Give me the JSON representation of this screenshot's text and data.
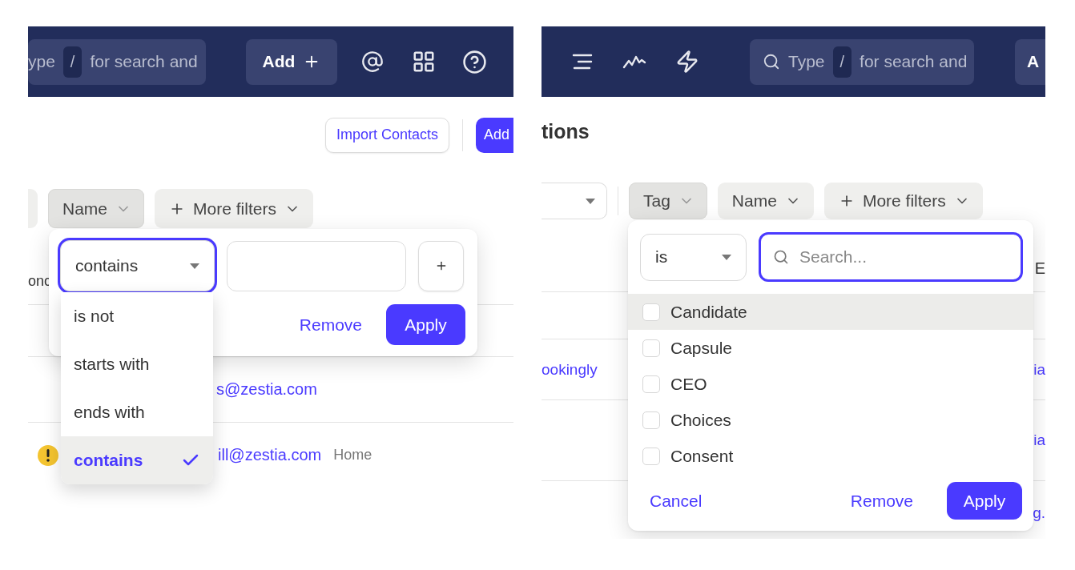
{
  "left_screen": {
    "header": {
      "search": {
        "before_key": "ype",
        "key": "/",
        "after_key": "for search and"
      },
      "add_button": "Add"
    },
    "actions": {
      "import_button": "Import Contacts",
      "add_button": "Add"
    },
    "filters": [
      {
        "kind": "stub",
        "open": false
      },
      {
        "kind": "chip",
        "label": "Name",
        "open": true
      },
      {
        "kind": "more",
        "label": "More filters",
        "open": false
      }
    ],
    "table": {
      "header_fragment": "onc",
      "rows": [
        {
          "warning": false
        },
        {
          "warning": false,
          "email": "s@zestia.com"
        },
        {
          "warning": true,
          "email": "ill@zestia.com",
          "type": "Home"
        }
      ]
    },
    "filter_popover": {
      "operator": "contains",
      "remove": "Remove",
      "apply": "Apply",
      "options": [
        {
          "label": "is not",
          "selected": false
        },
        {
          "label": "starts with",
          "selected": false
        },
        {
          "label": "ends with",
          "selected": false
        },
        {
          "label": "contains",
          "selected": true
        }
      ]
    }
  },
  "right_screen": {
    "header": {
      "search": {
        "before_key": "Type",
        "key": "/",
        "after_key": "for search and"
      },
      "add_button": "A"
    },
    "title": "tions",
    "filters": [
      {
        "kind": "select",
        "open": false
      },
      {
        "kind": "chip",
        "label": "Tag",
        "open": true
      },
      {
        "kind": "chip",
        "label": "Name",
        "open": false
      },
      {
        "kind": "more",
        "label": "More filters",
        "open": false
      }
    ],
    "table": {
      "header_fragment": "E",
      "rows": [
        {},
        {
          "left": "ookingly",
          "right": "ia"
        },
        {
          "right": "ia"
        },
        {
          "right": "g."
        }
      ]
    },
    "tag_popover": {
      "operator": "is",
      "search_placeholder": "Search...",
      "cancel": "Cancel",
      "remove": "Remove",
      "apply": "Apply",
      "tags": [
        {
          "label": "Candidate",
          "checked": false,
          "highlighted": true
        },
        {
          "label": "Capsule",
          "checked": false,
          "highlighted": false
        },
        {
          "label": "CEO",
          "checked": false,
          "highlighted": false
        },
        {
          "label": "Choices",
          "checked": false,
          "highlighted": false
        },
        {
          "label": "Consent",
          "checked": false,
          "highlighted": false
        }
      ]
    }
  }
}
